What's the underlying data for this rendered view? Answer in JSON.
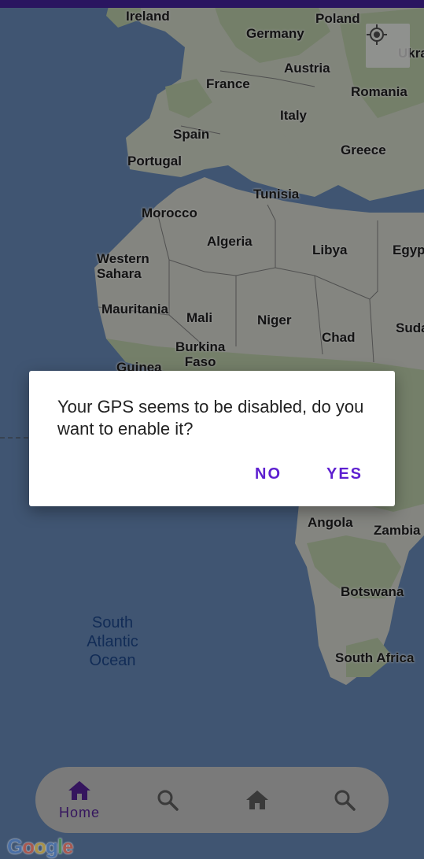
{
  "map": {
    "labels": {
      "ireland": "Ireland",
      "germany": "Germany",
      "poland": "Poland",
      "austria": "Austria",
      "france": "France",
      "romania": "Romania",
      "italy": "Italy",
      "spain": "Spain",
      "greece": "Greece",
      "portugal": "Portugal",
      "tunisia": "Tunisia",
      "morocco": "Morocco",
      "algeria": "Algeria",
      "libya": "Libya",
      "egypt": "Egyp",
      "western_sahara": "Western\nSahara",
      "mauritania": "Mauritania",
      "mali": "Mali",
      "niger": "Niger",
      "chad": "Chad",
      "sudan": "Suda",
      "burkina_faso": "Burkina\nFaso",
      "guinea": "Guinea",
      "ukraine": "Ukra",
      "angola": "Angola",
      "zambia": "Zambia",
      "botswana": "Botswana",
      "south_africa": "South Africa"
    },
    "ocean_label": "South\nAtlantic\nOcean",
    "google_logo": [
      "G",
      "o",
      "o",
      "g",
      "l",
      "e"
    ],
    "colors": {
      "land": "#e4e6dd",
      "forest": "#c7dcb3",
      "water": "#6e93c5"
    }
  },
  "dialog": {
    "message": "Your GPS seems to be disabled, do you want to enable it?",
    "no_label": "NO",
    "yes_label": "YES"
  },
  "bottom_nav": {
    "items": [
      {
        "label": "Home",
        "icon": "home-icon",
        "active": true
      },
      {
        "label": "",
        "icon": "search-icon",
        "active": false
      },
      {
        "label": "",
        "icon": "home-icon",
        "active": false
      },
      {
        "label": "",
        "icon": "search-icon",
        "active": false
      }
    ]
  },
  "colors": {
    "accent": "#5d1fd0",
    "status_bar": "#2a1560",
    "nav_active": "#35155e",
    "nav_inactive": "#3a3a3a"
  }
}
